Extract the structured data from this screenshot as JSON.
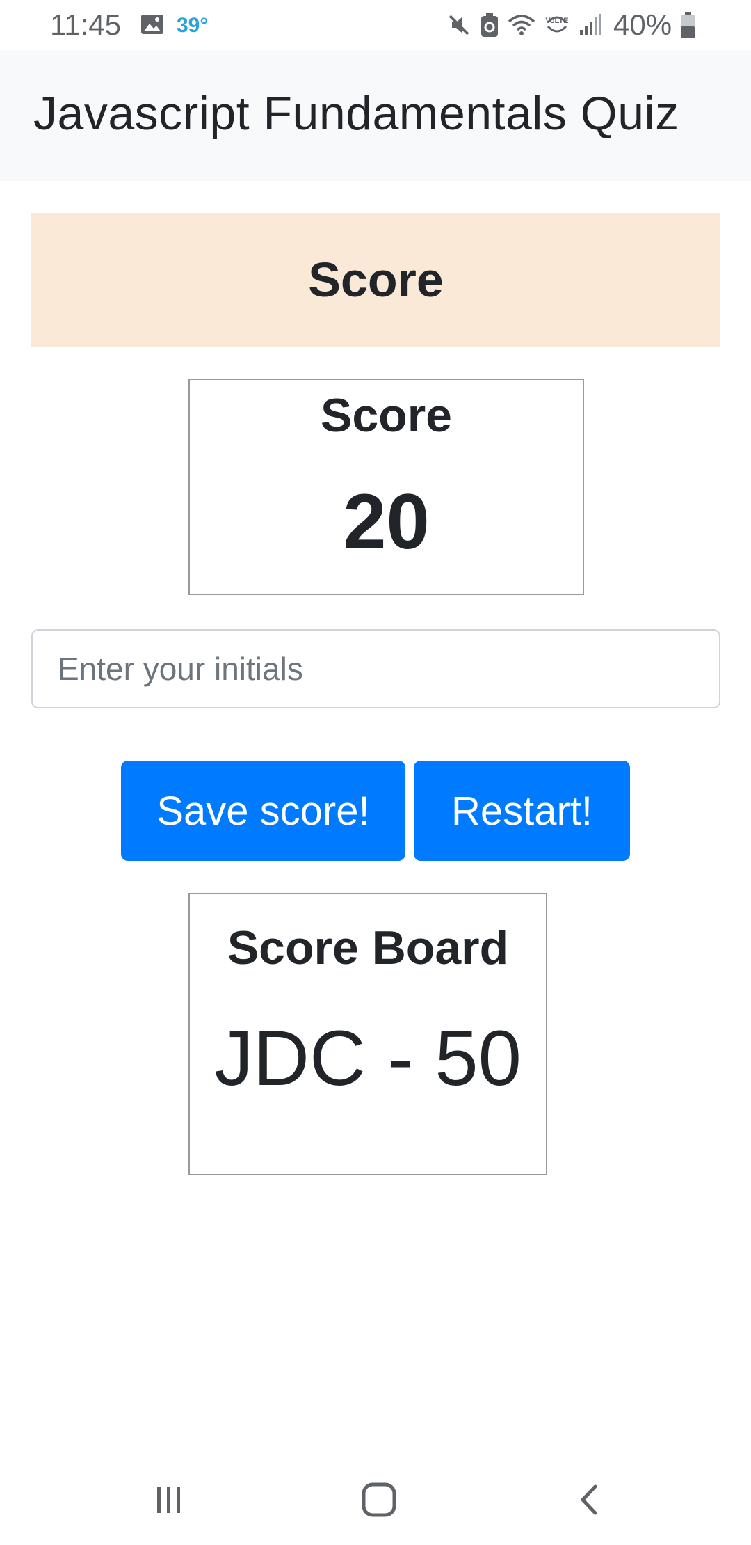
{
  "status_bar": {
    "time": "11:45",
    "temperature": "39°",
    "battery": "40%",
    "icons": [
      "image-icon",
      "mute-icon",
      "battery-saver-icon",
      "wifi-icon",
      "volte-icon",
      "signal-icon",
      "battery-icon"
    ]
  },
  "navbar": {
    "title": "Javascript Fundamentals Quiz"
  },
  "score_header": {
    "title": "Score"
  },
  "score_card": {
    "label": "Score",
    "value": "20"
  },
  "initials": {
    "placeholder": "Enter your initials",
    "value": ""
  },
  "buttons": {
    "save_label": "Save score!",
    "restart_label": "Restart!"
  },
  "score_board": {
    "label": "Score Board",
    "entries": [
      "JDC - 50"
    ]
  },
  "system_nav": {
    "icons": [
      "recents-icon",
      "home-icon",
      "back-icon"
    ]
  },
  "colors": {
    "primary": "#007bff",
    "header_bg": "#f9e9d6",
    "navbar_bg": "#f8f9fa",
    "temperature": "#2aa3d8"
  }
}
